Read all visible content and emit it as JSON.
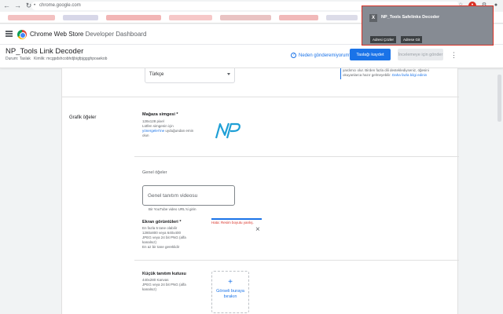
{
  "browser": {
    "url": "chrome.google.com",
    "nav": {
      "back": "←",
      "forward": "→",
      "reload": "↻",
      "home": "⌂"
    }
  },
  "app": {
    "title_main": "Chrome Web Store",
    "title_sub": "Developer Dashboard"
  },
  "item": {
    "title": "NP_Tools Link Decoder",
    "status_label": "Durum: Taslak",
    "id_label": "Kimlik: mcgpdshcobhdjbigfpjggghpoaekob",
    "help_link": "Neden gönderemiyorum?",
    "save_draft": "Taslağı kaydet",
    "submit_review": "İncelemeye için gönder"
  },
  "listing": {
    "language_value": "Türkçe",
    "side_text": "yardımcı olur. Birden fazla dili desteklediyseniz, öğesini okuyanlarca hazır gelmeyebilir.",
    "side_link": "Daha fazla bilgi edinin"
  },
  "graphics": {
    "section_label": "Grafik öğeler",
    "store_icon_title": "Mağaza simgesi *",
    "store_icon_desc": "128x128 pixel",
    "store_icon_desc2": "Lütfen simgenin için",
    "store_icon_link": "yönergeler'ine",
    "store_icon_desc3": "uyduğundan emin olun",
    "general_label": "Genel öğeler",
    "video_placeholder": "Genel tanıtım videosu",
    "video_help": "Bir YouTube video URL'si girin",
    "screenshots_title": "Ekran görüntüleri *",
    "screenshots_desc1": "En fazla 5 tane olabilir",
    "screenshots_desc2": "1280x800 veya 640x400",
    "screenshots_desc3": "JPEG veya 24 bit PNG (alfa kanalsız)",
    "screenshots_desc4": "En az bir tane gereklidir",
    "screenshot_error": "Hata: Resim boyutu yanlış.",
    "small_promo_title": "Küçük tanıtım kutusu",
    "small_promo_desc1": "440x280 Kanvas",
    "small_promo_desc2": "JPEG veya 24 bit PNG (alfa kanalsız)",
    "upload_plus": "+",
    "upload_text": "Görseli buraya bırakın"
  },
  "extension_popup": {
    "icon_letter": "X",
    "title": "NP_Tools Safelinks Decoder",
    "button1": "Adresi Çözler",
    "button2": "Adrese Git"
  },
  "colors": {
    "primary": "#1a73e8",
    "error": "#d93025",
    "logo_blue": "#1e9fd6"
  }
}
